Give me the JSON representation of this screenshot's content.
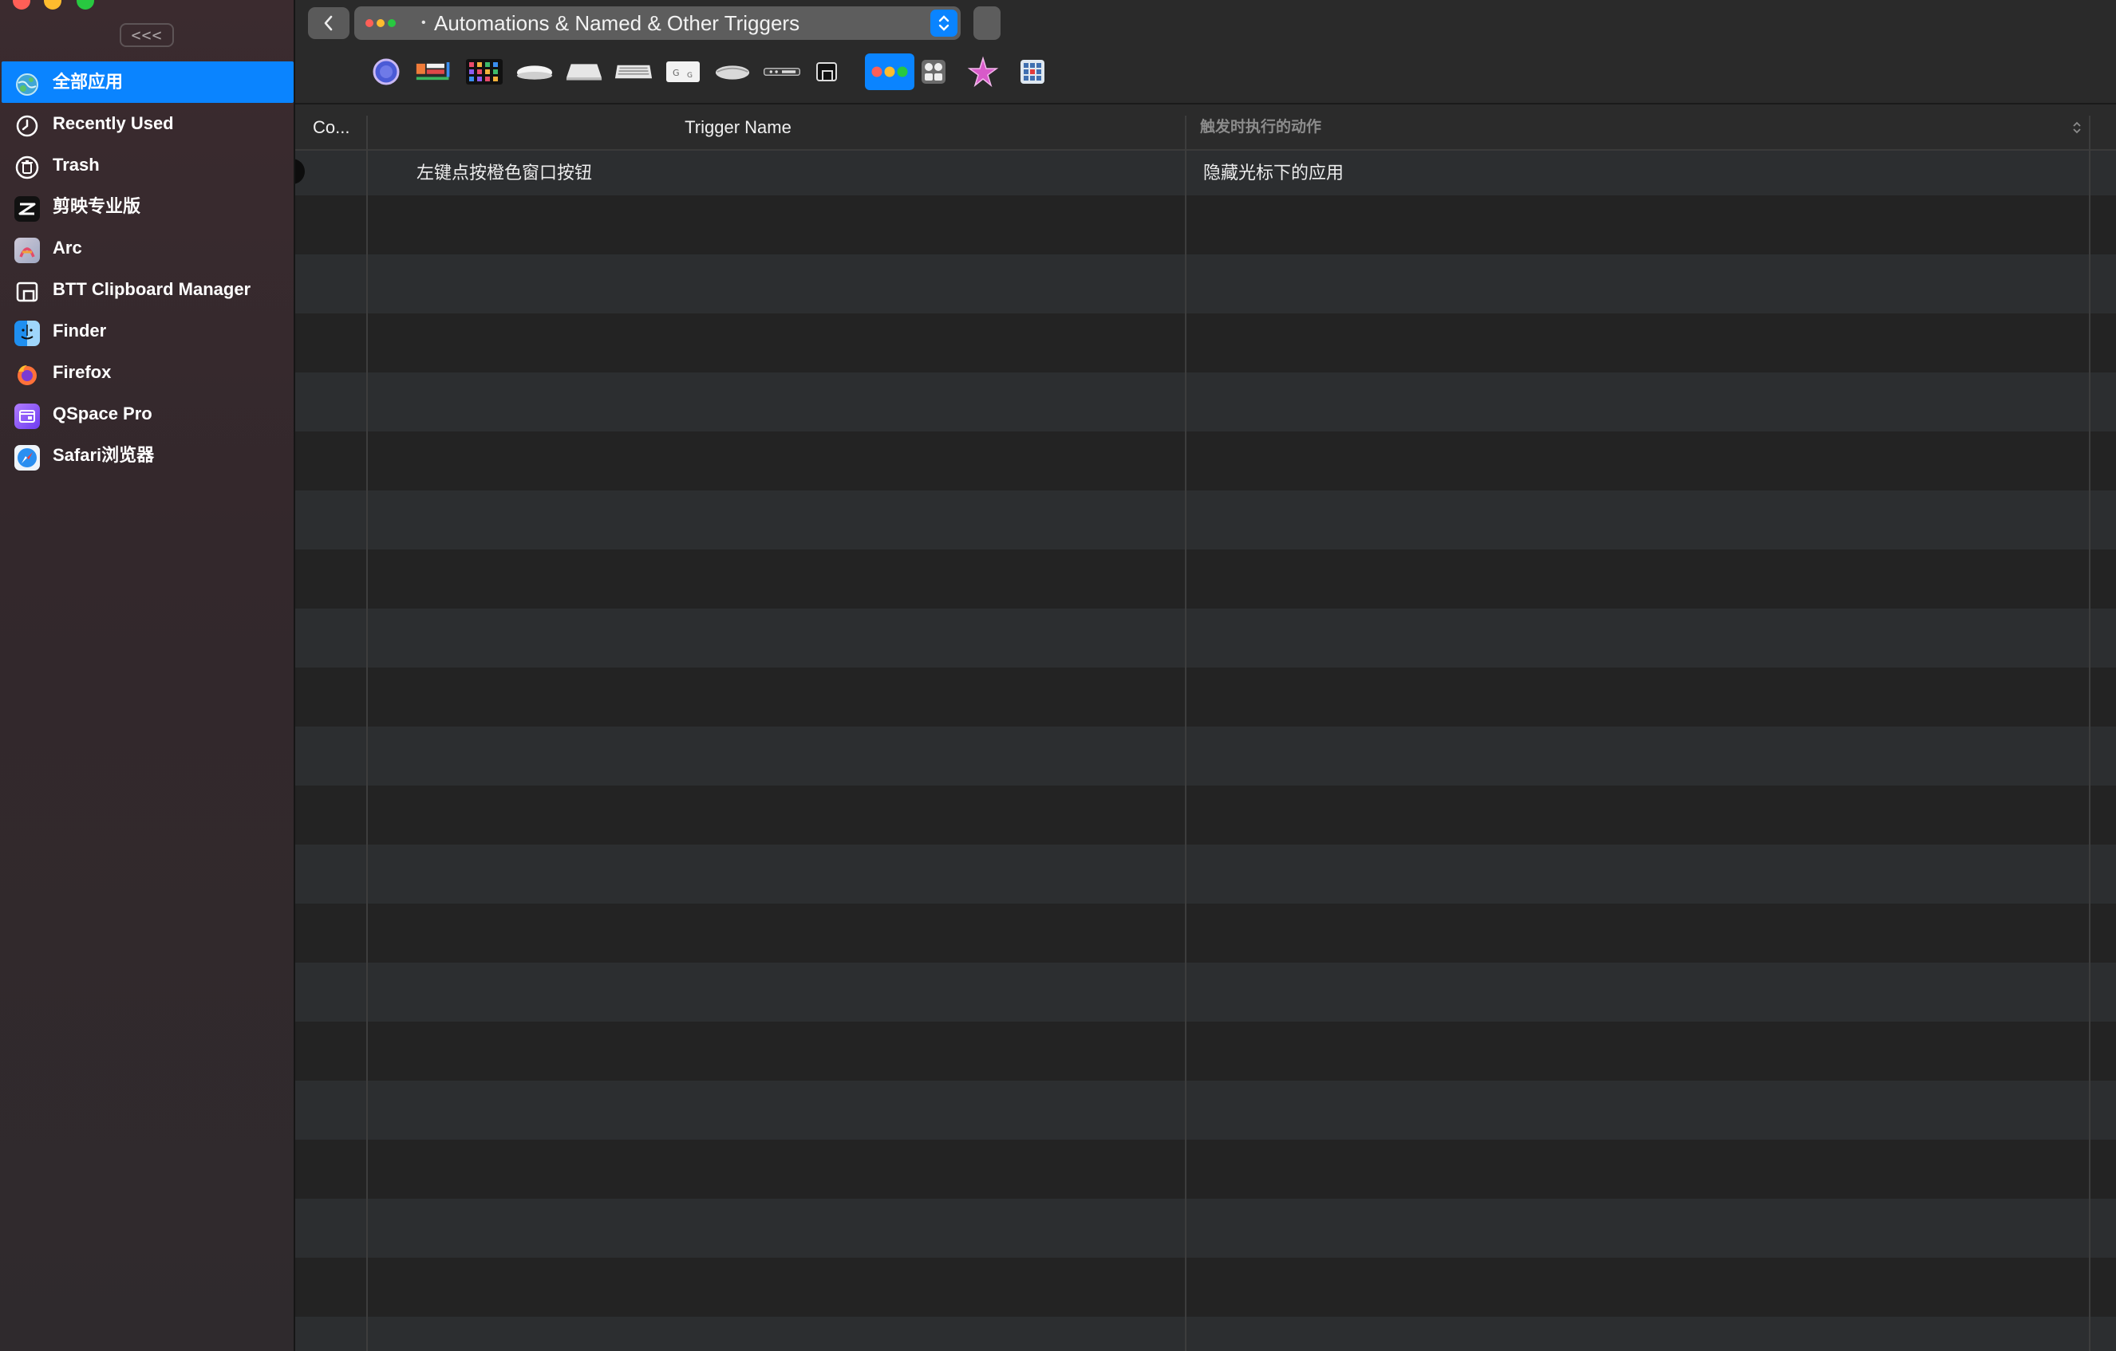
{
  "window": {
    "collapse_label": "<<<"
  },
  "sidebar": {
    "items": [
      {
        "label": "全部应用",
        "icon": "globe-apps-icon",
        "selected": true
      },
      {
        "label": "Recently Used",
        "icon": "clock-icon"
      },
      {
        "label": "Trash",
        "icon": "trash-icon"
      },
      {
        "label": "剪映专业版",
        "icon": "capcut-icon"
      },
      {
        "label": "Arc",
        "icon": "arc-icon"
      },
      {
        "label": "BTT Clipboard Manager",
        "icon": "clipboard-icon"
      },
      {
        "label": "Finder",
        "icon": "finder-icon"
      },
      {
        "label": "Firefox",
        "icon": "firefox-icon"
      },
      {
        "label": "QSpace Pro",
        "icon": "qspace-icon"
      },
      {
        "label": "Safari浏览器",
        "icon": "safari-icon"
      }
    ]
  },
  "toolbar": {
    "trigger_type_selected": "Automations & Named & Other Triggers",
    "accent_color": "#0a84ff",
    "trigger_icons": [
      "siri-orb-icon",
      "touch-bar-icon",
      "stream-deck-icon",
      "magic-mouse-icon",
      "trackpad-icon",
      "keyboard-icon",
      "shortcut-keys-icon",
      "generic-mouse-icon",
      "siri-remote-icon",
      "notch-icon",
      "window-buttons-icon",
      "control-center-icon",
      "starfish-icon",
      "touchbar-grid-icon"
    ]
  },
  "table": {
    "columns": {
      "co": "Co...",
      "name": "Trigger Name",
      "action": "触发时执行的动作"
    },
    "rows": [
      {
        "name": "左键点按橙色窗口按钮",
        "action": "隐藏光标下的应用"
      }
    ]
  }
}
